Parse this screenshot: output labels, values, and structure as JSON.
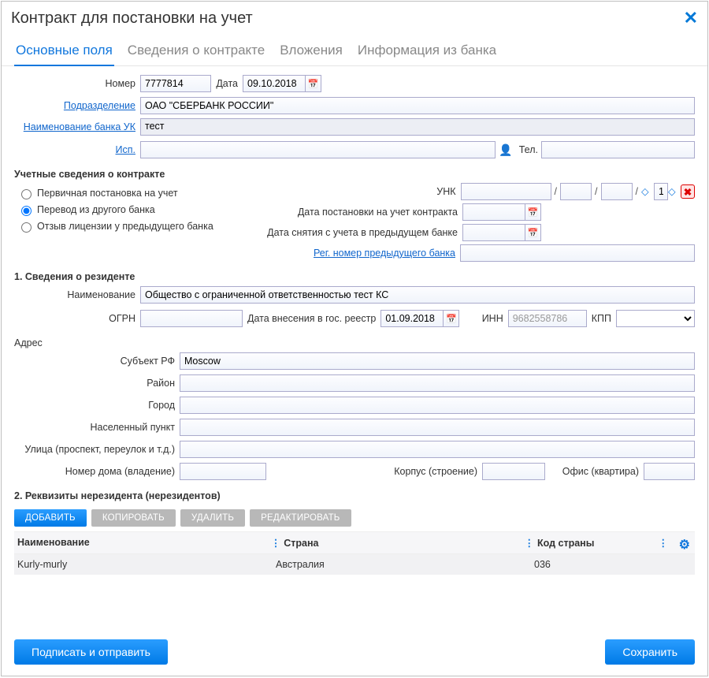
{
  "title": "Контракт для постановки на учет",
  "tabs": {
    "main": "Основные поля",
    "details": "Сведения о контракте",
    "attachments": "Вложения",
    "bankinfo": "Информация из банка"
  },
  "fields": {
    "number_lbl": "Номер",
    "number_val": "7777814",
    "date_lbl": "Дата",
    "date_val": "09.10.2018",
    "division_lbl": "Подразделение",
    "division_val": "ОАО \"СБЕРБАНК РОССИИ\"",
    "bank_uk_lbl": "Наименование банка УК",
    "bank_uk_val": "тест",
    "isp_lbl": "Исп.",
    "isp_val": "",
    "tel_lbl": "Тел.",
    "tel_val": ""
  },
  "accounting": {
    "section": "Учетные сведения о контракте",
    "radio1": "Первичная постановка на учет",
    "radio2": "Перевод из другого банка",
    "radio3": "Отзыв лицензии у предыдущего банка",
    "unk_lbl": "УНК",
    "unk5": "1",
    "reg_date_lbl": "Дата постановки на учет контракта",
    "dereg_date_lbl": "Дата снятия с учета в предыдущем банке",
    "prev_bank_lbl": "Рег. номер предыдущего банка"
  },
  "resident": {
    "section": "1. Сведения о резиденте",
    "name_lbl": "Наименование",
    "name_val": "Общество с ограниченной ответственностью тест КС",
    "ogrn_lbl": "ОГРН",
    "ogrn_val": "",
    "gosreg_date_lbl": "Дата внесения в гос. реестр",
    "gosreg_date_val": "01.09.2018",
    "inn_lbl": "ИНН",
    "inn_placeholder": "9682558786",
    "kpp_lbl": "КПП"
  },
  "address": {
    "section": "Адрес",
    "subject_lbl": "Субъект РФ",
    "subject_val": "Moscow",
    "district_lbl": "Район",
    "city_lbl": "Город",
    "locality_lbl": "Населенный пункт",
    "street_lbl": "Улица (проспект, переулок и т.д.)",
    "house_lbl": "Номер дома (владение)",
    "block_lbl": "Корпус (строение)",
    "office_lbl": "Офис (квартира)"
  },
  "nonresident": {
    "section": "2. Реквизиты нерезидента (нерезидентов)",
    "btn_add": "ДОБАВИТЬ",
    "btn_copy": "КОПИРОВАТЬ",
    "btn_del": "УДАЛИТЬ",
    "btn_edit": "РЕДАКТИРОВАТЬ",
    "col_name": "Наименование",
    "col_country": "Страна",
    "col_code": "Код страны",
    "row1_name": "Kurly-murly",
    "row1_country": "Австралия",
    "row1_code": "036"
  },
  "footer": {
    "sign_send": "Подписать и отправить",
    "save": "Сохранить"
  }
}
